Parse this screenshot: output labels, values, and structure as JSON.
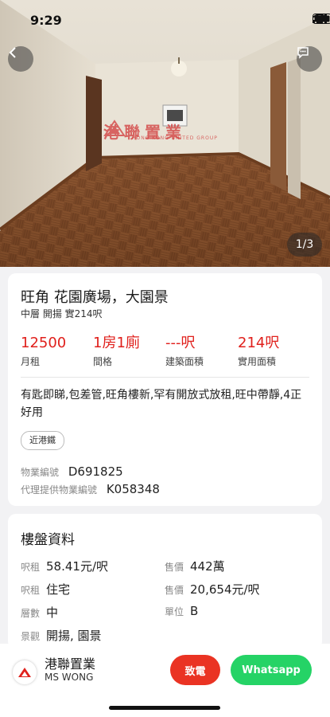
{
  "status": {
    "time": "9:29"
  },
  "hero": {
    "counter": "1/3",
    "watermark_text": "港聯置業",
    "watermark_sub": "HONG KONG UNITED GROUP"
  },
  "listing": {
    "title": "旺角 花園廣場，大園景",
    "subtitle": "中層 開揚 實214呎",
    "stats": [
      {
        "value": "12500",
        "label": "月租"
      },
      {
        "value": "1房1廁",
        "label": "間格"
      },
      {
        "value": "---呎",
        "label": "建築面積"
      },
      {
        "value": "214呎",
        "label": "實用面積"
      }
    ],
    "description": "有匙即睇,包差管,旺角樓新,罕有開放式放租,旺中帶靜,4正好用",
    "tag": "近港鐵",
    "property_id_label": "物業編號",
    "property_id": "D691825",
    "agent_id_label": "代理提供物業編號",
    "agent_id": "K058348"
  },
  "details": {
    "section_title": "樓盤資料",
    "rows": [
      {
        "l1": "呎租",
        "v1": "58.41元/呎",
        "l2": "售價",
        "v2": "442萬"
      },
      {
        "l1": "呎租",
        "v1": "住宅",
        "l2": "售價",
        "v2": "20,654元/呎"
      },
      {
        "l1": "層數",
        "v1": "中",
        "l2": "單位",
        "v2": "B"
      },
      {
        "l1": "景觀",
        "v1": "開揚, 園景"
      }
    ]
  },
  "agent": {
    "company": "港聯置業",
    "person": "MS WONG",
    "call_label": "致電",
    "whatsapp_label": "Whatsapp"
  },
  "colors": {
    "accent_red": "#e0201c",
    "call_red": "#ea3323",
    "whatsapp_green": "#25d366"
  }
}
